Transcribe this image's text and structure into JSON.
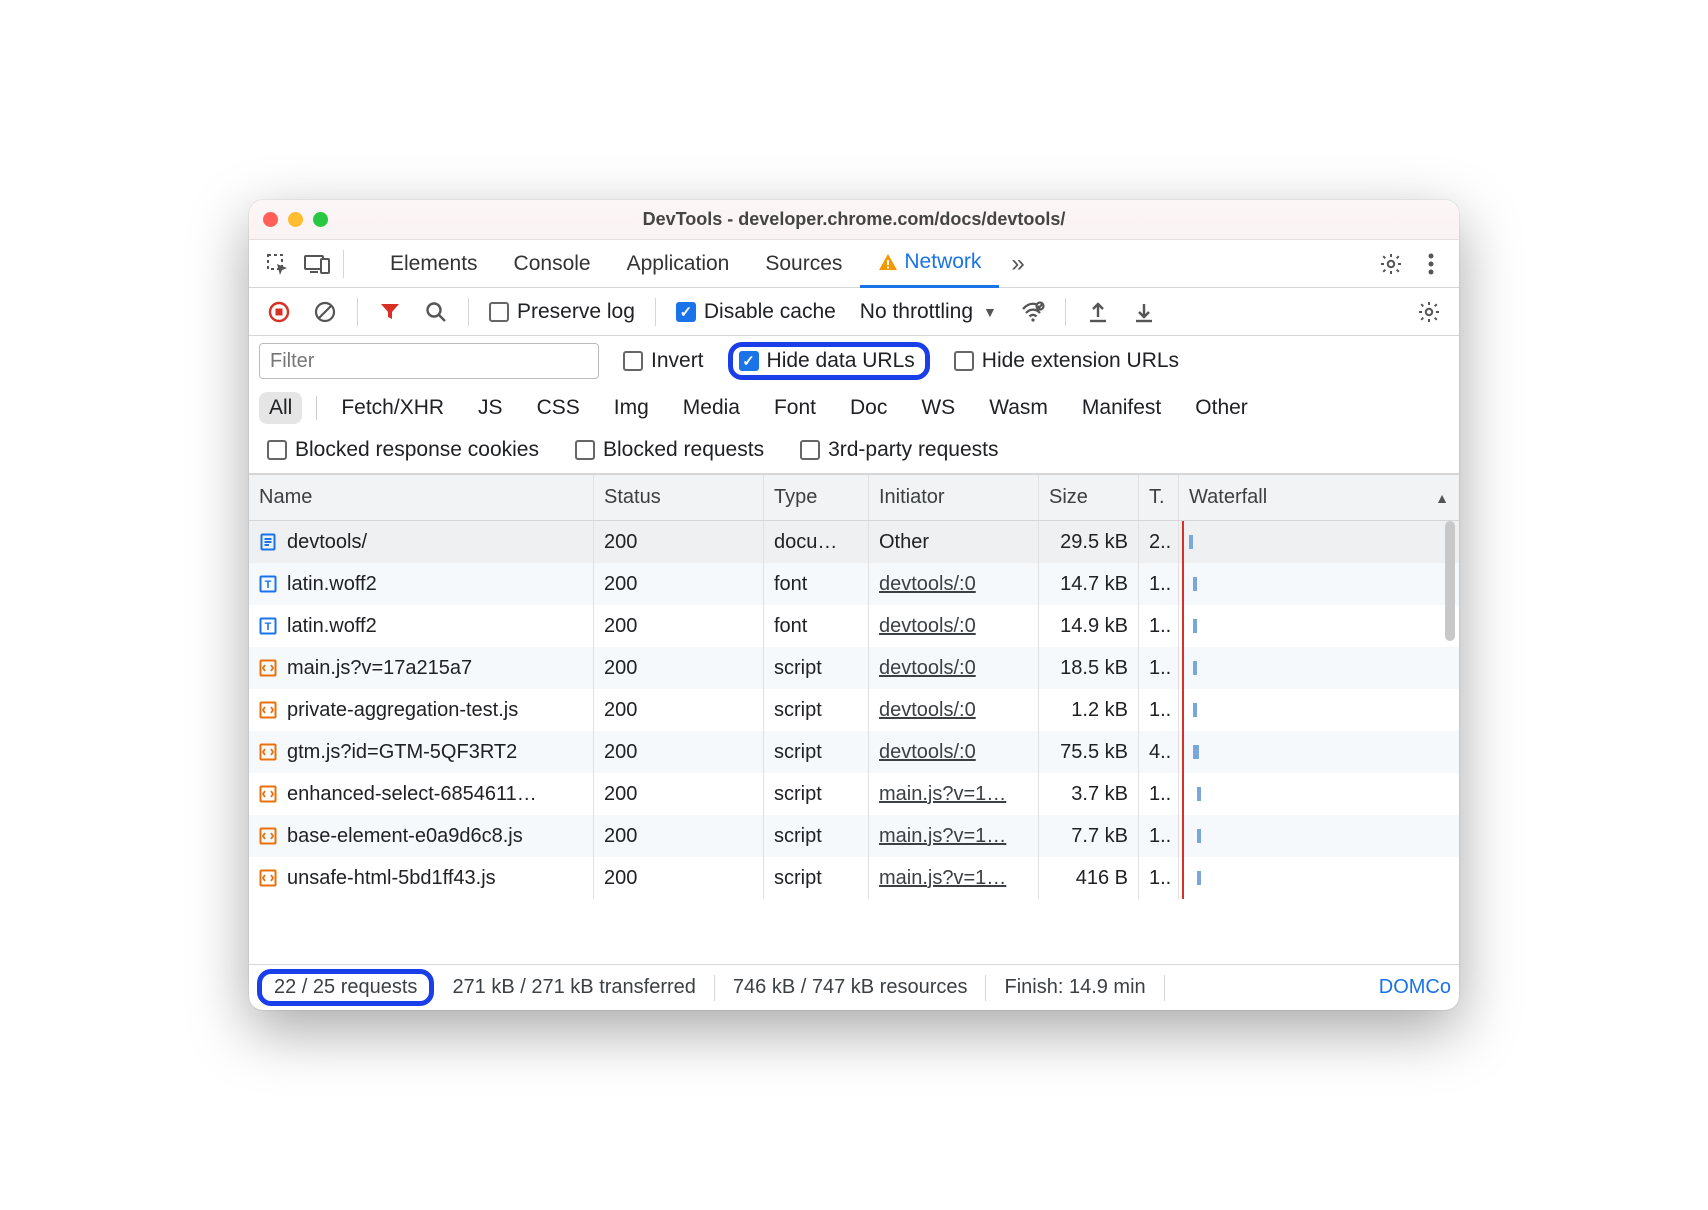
{
  "window": {
    "title": "DevTools - developer.chrome.com/docs/devtools/"
  },
  "tabs": {
    "items": [
      "Elements",
      "Console",
      "Application",
      "Sources",
      "Network"
    ],
    "active": "Network"
  },
  "toolbar": {
    "preserve_log": "Preserve log",
    "disable_cache": "Disable cache",
    "throttling": "No throttling"
  },
  "filter": {
    "placeholder": "Filter",
    "invert": "Invert",
    "hide_data_urls": "Hide data URLs",
    "hide_extension_urls": "Hide extension URLs"
  },
  "types": [
    "All",
    "Fetch/XHR",
    "JS",
    "CSS",
    "Img",
    "Media",
    "Font",
    "Doc",
    "WS",
    "Wasm",
    "Manifest",
    "Other"
  ],
  "blocked": {
    "cookies": "Blocked response cookies",
    "requests": "Blocked requests",
    "third": "3rd-party requests"
  },
  "columns": {
    "name": "Name",
    "status": "Status",
    "type": "Type",
    "initiator": "Initiator",
    "size": "Size",
    "time": "T.",
    "waterfall": "Waterfall"
  },
  "rows": [
    {
      "icon": "doc",
      "name": "devtools/",
      "status": "200",
      "type": "docu…",
      "initiator": "Other",
      "ilink": false,
      "size": "29.5 kB",
      "time": "2..",
      "wx": 10,
      "ww": 4
    },
    {
      "icon": "font",
      "name": "latin.woff2",
      "status": "200",
      "type": "font",
      "initiator": "devtools/:0",
      "ilink": true,
      "size": "14.7 kB",
      "time": "1..",
      "wx": 14,
      "ww": 4
    },
    {
      "icon": "font",
      "name": "latin.woff2",
      "status": "200",
      "type": "font",
      "initiator": "devtools/:0",
      "ilink": true,
      "size": "14.9 kB",
      "time": "1..",
      "wx": 14,
      "ww": 4
    },
    {
      "icon": "js",
      "name": "main.js?v=17a215a7",
      "status": "200",
      "type": "script",
      "initiator": "devtools/:0",
      "ilink": true,
      "size": "18.5 kB",
      "time": "1..",
      "wx": 14,
      "ww": 4
    },
    {
      "icon": "js",
      "name": "private-aggregation-test.js",
      "status": "200",
      "type": "script",
      "initiator": "devtools/:0",
      "ilink": true,
      "size": "1.2 kB",
      "time": "1..",
      "wx": 14,
      "ww": 4
    },
    {
      "icon": "js",
      "name": "gtm.js?id=GTM-5QF3RT2",
      "status": "200",
      "type": "script",
      "initiator": "devtools/:0",
      "ilink": true,
      "size": "75.5 kB",
      "time": "4..",
      "wx": 14,
      "ww": 6
    },
    {
      "icon": "js",
      "name": "enhanced-select-6854611…",
      "status": "200",
      "type": "script",
      "initiator": "main.js?v=1…",
      "ilink": true,
      "size": "3.7 kB",
      "time": "1..",
      "wx": 18,
      "ww": 4
    },
    {
      "icon": "js",
      "name": "base-element-e0a9d6c8.js",
      "status": "200",
      "type": "script",
      "initiator": "main.js?v=1…",
      "ilink": true,
      "size": "7.7 kB",
      "time": "1..",
      "wx": 18,
      "ww": 4
    },
    {
      "icon": "js",
      "name": "unsafe-html-5bd1ff43.js",
      "status": "200",
      "type": "script",
      "initiator": "main.js?v=1…",
      "ilink": true,
      "size": "416 B",
      "time": "1..",
      "wx": 18,
      "ww": 4
    }
  ],
  "status": {
    "requests": "22 / 25 requests",
    "transferred": "271 kB / 271 kB transferred",
    "resources": "746 kB / 747 kB resources",
    "finish": "Finish: 14.9 min",
    "domco": "DOMCo"
  }
}
